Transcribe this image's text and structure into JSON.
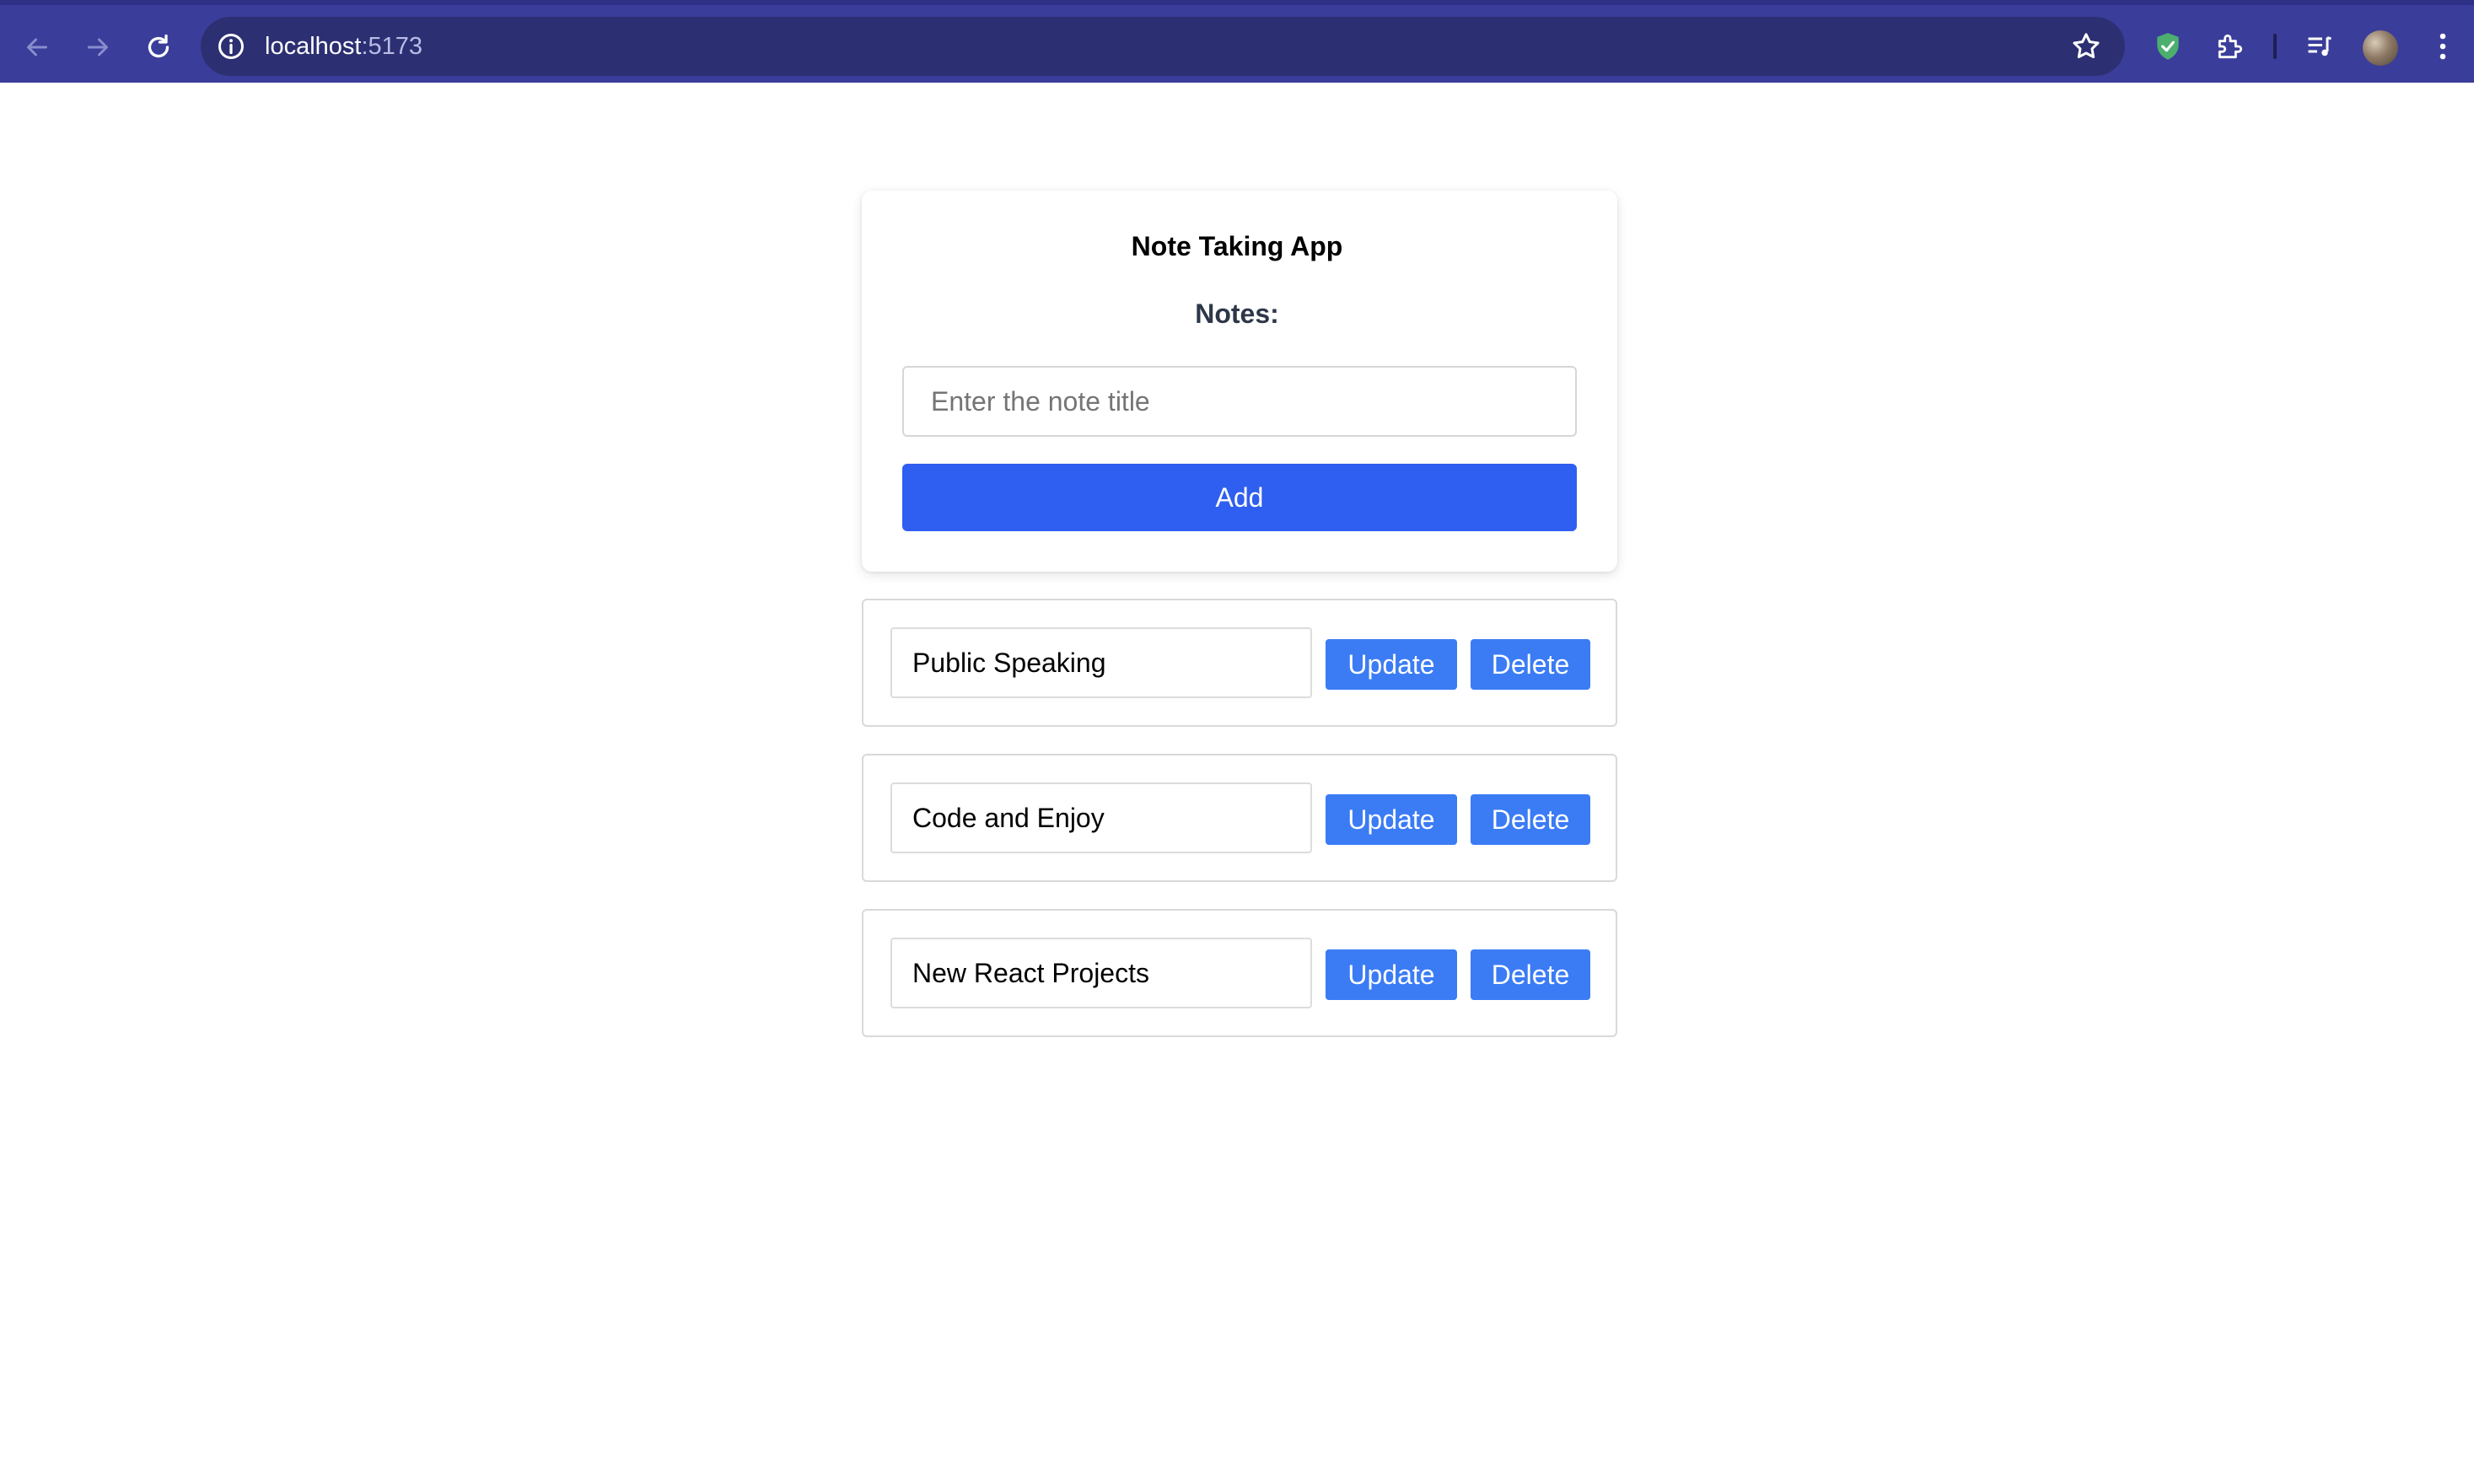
{
  "browser": {
    "url_host": "localhost",
    "url_port": ":5173",
    "icons": {
      "back": "back-arrow-icon",
      "forward": "forward-arrow-icon",
      "reload": "reload-icon",
      "site_info": "info-icon",
      "bookmark": "star-icon",
      "shield": "shield-icon",
      "extensions": "puzzle-icon",
      "media": "media-playlist-icon",
      "menu": "kebab-menu-icon"
    },
    "colors": {
      "toolbar": "#3a3d9a",
      "omnibox": "#2c2f72"
    }
  },
  "app": {
    "title": "Note Taking App",
    "notes_label": "Notes:",
    "input_placeholder": "Enter the note title",
    "input_value": "",
    "add_label": "Add",
    "colors": {
      "add_button": "#2f5ff0",
      "note_buttons": "#3b7cf5"
    }
  },
  "notes": [
    {
      "title": "Public Speaking",
      "update_label": "Update",
      "delete_label": "Delete"
    },
    {
      "title": "Code and Enjoy",
      "update_label": "Update",
      "delete_label": "Delete"
    },
    {
      "title": "New React Projects",
      "update_label": "Update",
      "delete_label": "Delete"
    }
  ]
}
